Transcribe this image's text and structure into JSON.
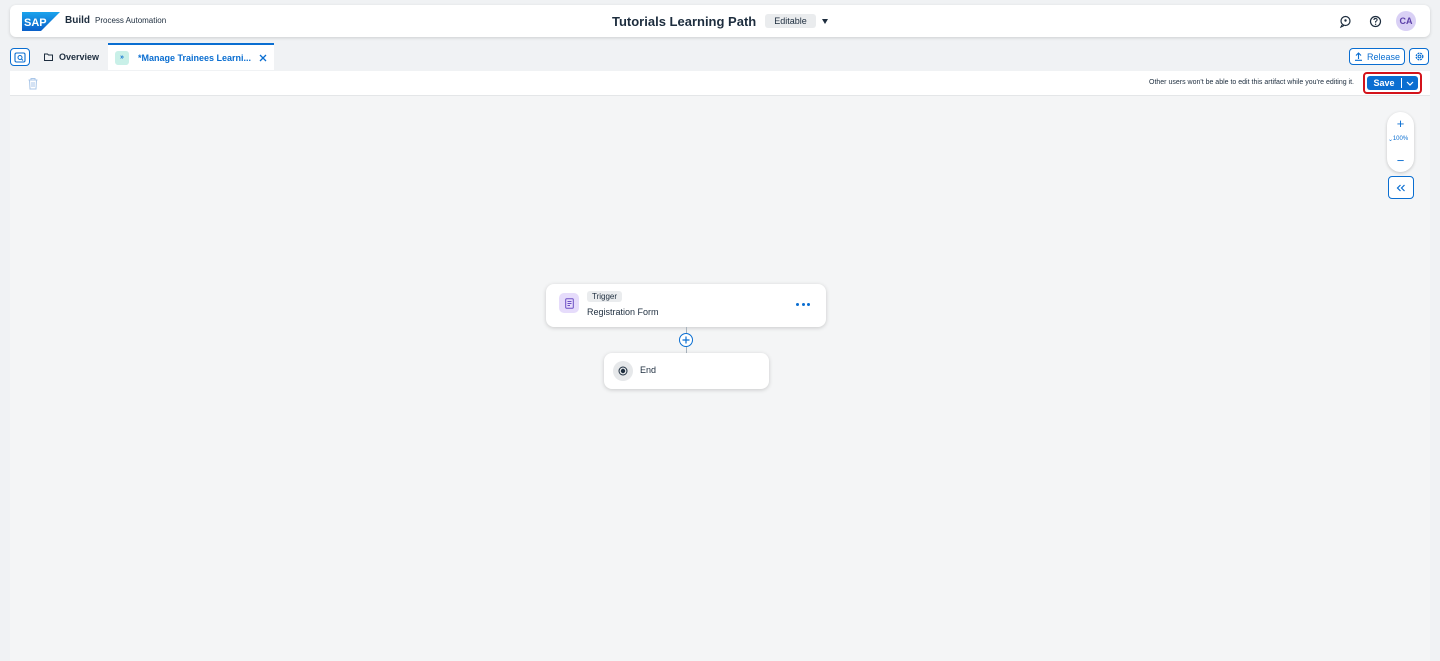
{
  "shell": {
    "brand": "Build",
    "product": "Process Automation",
    "title": "Tutorials Learning Path",
    "status": "Editable",
    "icons": [
      "feedback-icon",
      "help-icon"
    ],
    "avatar": "CA"
  },
  "tabs": {
    "overview_label": "Overview",
    "active_label": "*Manage Trainees Learni...",
    "release_label": "Release"
  },
  "toolbar": {
    "message": "Other users won't be able to edit this artifact while you're editing it.",
    "save_label": "Save"
  },
  "canvas": {
    "zoom_level": "100%",
    "trigger": {
      "badge": "Trigger",
      "name": "Registration Form"
    },
    "end": {
      "label": "End"
    }
  },
  "colors": {
    "accent": "#0a6ed1",
    "highlight": "#d3131b",
    "form_icon_bg": "#e6dcfb",
    "process_icon_bg": "#c9f0e8"
  }
}
